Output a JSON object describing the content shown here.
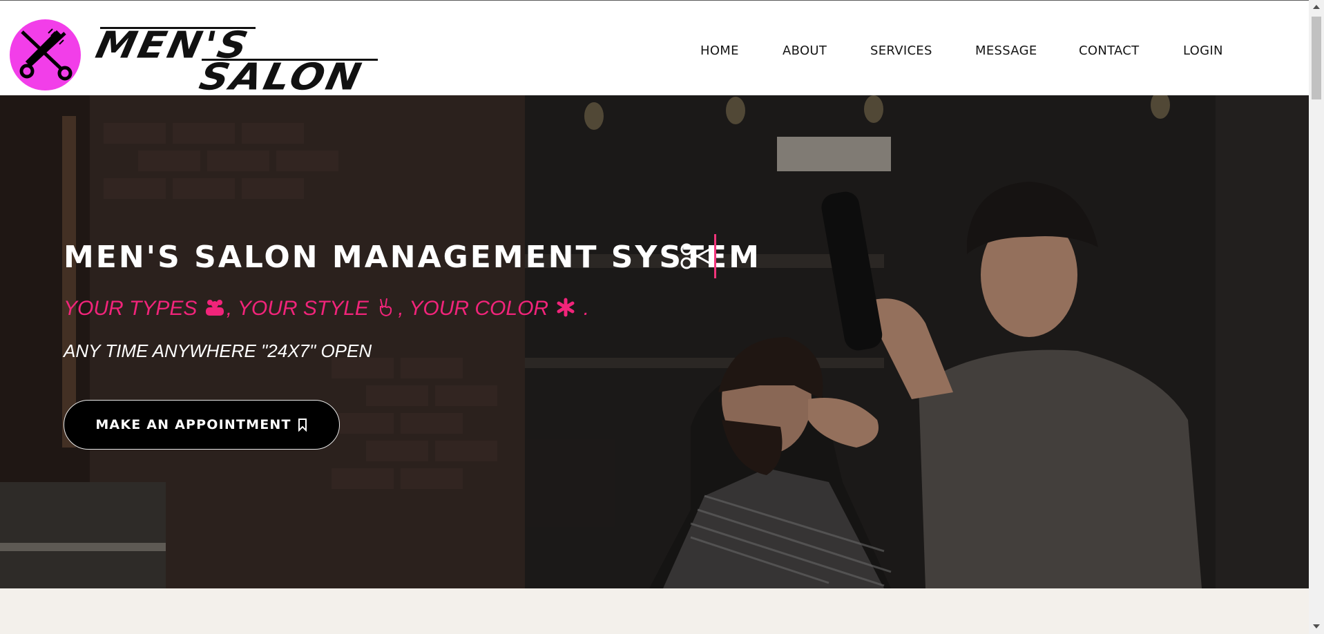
{
  "brand": {
    "line1": "MEN'S",
    "line2": "SALON",
    "logo_icon": "scissors-comb-icon",
    "logo_color": "#f23ee9"
  },
  "nav": {
    "items": [
      {
        "label": "HOME"
      },
      {
        "label": "ABOUT"
      },
      {
        "label": "SERVICES"
      },
      {
        "label": "MESSAGE"
      },
      {
        "label": "CONTACT"
      },
      {
        "label": "LOGIN"
      }
    ]
  },
  "hero": {
    "title": "MEN'S SALON MANAGEMENT SYSTEM",
    "title_icon": "scissors-icon",
    "tagline_part1": "YOUR TYPES",
    "tagline_part2": ", YOUR STYLE",
    "tagline_part3": ", YOUR COLOR",
    "tagline_end": ".",
    "tagline_icons": [
      "group-icon",
      "victory-hand-icon",
      "asterisk-icon"
    ],
    "subline": "ANY TIME ANYWHERE \"24X7\" OPEN",
    "cta_label": "MAKE AN APPOINTMENT",
    "cta_icon": "bookmark-icon",
    "accent_color": "#f1247a"
  }
}
